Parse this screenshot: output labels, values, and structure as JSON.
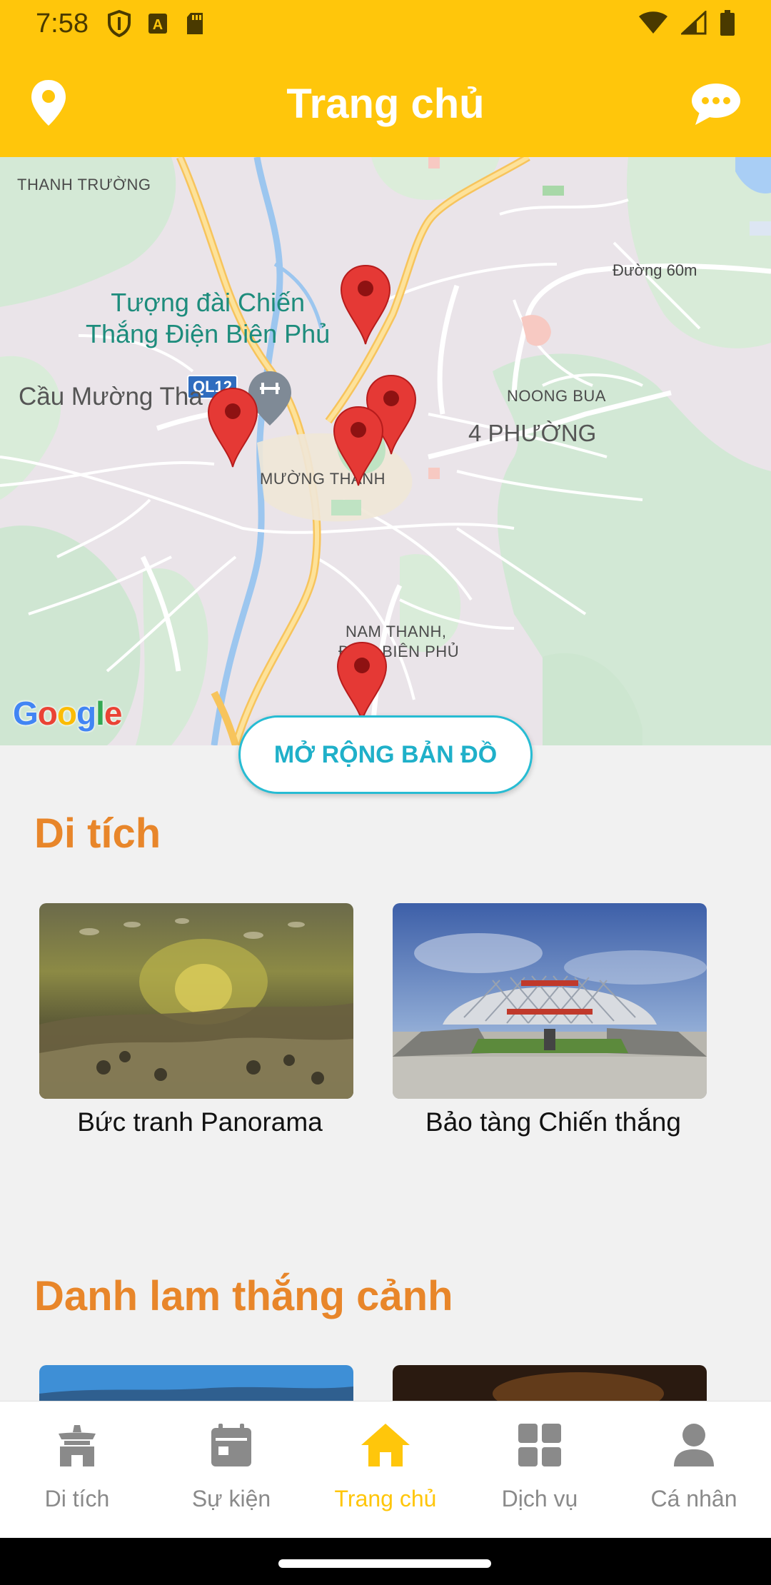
{
  "status_bar": {
    "time": "7:58"
  },
  "app_bar": {
    "title": "Trang chủ"
  },
  "map": {
    "labels": {
      "thanh_truong": "THANH TRƯỜNG",
      "ql12": "QL12",
      "duong_60m": "Đường 60m",
      "tuong_dai_line1": "Tượng đài Chiến",
      "tuong_dai_line2": "Thắng Điện Biên Phủ",
      "cau_muong_thanh": "Cầu Mường Tha",
      "noong_bua": "NOONG BUA",
      "bon_phuong": "4 PHƯỜNG",
      "muong_thanh": "MƯỜNG THANH",
      "nam_thanh_line1": "NAM THANH,",
      "nam_thanh_line2": "ĐIỆN BIÊN PHỦ"
    },
    "google_logo": "Google",
    "expand_button": "MỞ RỘNG BẢN ĐỒ"
  },
  "sections": {
    "di_tich": {
      "title": "Di tích",
      "cards": [
        {
          "caption": "Bức tranh Panorama"
        },
        {
          "caption": "Bảo tàng Chiến thắng"
        }
      ]
    },
    "danh_lam": {
      "title": "Danh lam thắng cảnh"
    }
  },
  "bottom_nav": {
    "items": [
      {
        "label": "Di tích",
        "icon": "temple-icon"
      },
      {
        "label": "Sự kiện",
        "icon": "calendar-icon"
      },
      {
        "label": "Trang chủ",
        "icon": "home-icon"
      },
      {
        "label": "Dịch vụ",
        "icon": "grid-icon"
      },
      {
        "label": "Cá nhân",
        "icon": "person-icon"
      }
    ],
    "active_index": 2
  },
  "colors": {
    "primary": "#ffc60b",
    "section_title": "#e8862a",
    "accent": "#1fb0c9",
    "pin": "#e53935"
  }
}
